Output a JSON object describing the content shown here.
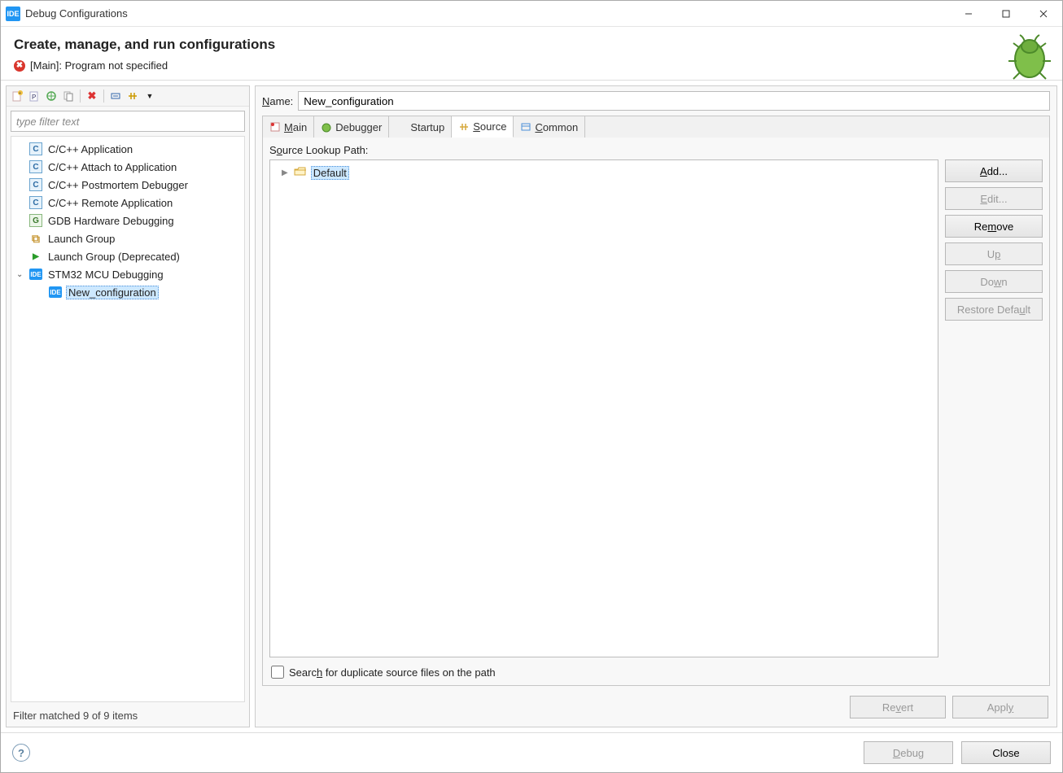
{
  "window": {
    "title": "Debug Configurations"
  },
  "header": {
    "heading": "Create, manage, and run configurations",
    "errorText": "[Main]: Program not specified"
  },
  "leftPane": {
    "filterPlaceholder": "type filter text",
    "statusText": "Filter matched 9 of 9 items",
    "treeItems": [
      {
        "iconType": "c",
        "label": "C/C++ Application"
      },
      {
        "iconType": "c",
        "label": "C/C++ Attach to Application"
      },
      {
        "iconType": "c",
        "label": "C/C++ Postmortem Debugger"
      },
      {
        "iconType": "c",
        "label": "C/C++ Remote Application"
      },
      {
        "iconType": "g",
        "label": "GDB Hardware Debugging"
      },
      {
        "iconType": "grp",
        "label": "Launch Group"
      },
      {
        "iconType": "play",
        "label": "Launch Group (Deprecated)"
      },
      {
        "iconType": "ide",
        "label": "STM32 MCU Debugging",
        "expanded": true
      },
      {
        "iconType": "ide",
        "label": "New_configuration",
        "child": true,
        "selected": true
      }
    ]
  },
  "rightPane": {
    "nameLabel": "Name:",
    "nameValue": "New_configuration",
    "tabs": [
      {
        "id": "main",
        "label": "Main"
      },
      {
        "id": "debugger",
        "label": "Debugger"
      },
      {
        "id": "startup",
        "label": "Startup"
      },
      {
        "id": "source",
        "label": "Source",
        "active": true
      },
      {
        "id": "common",
        "label": "Common"
      }
    ],
    "source": {
      "lookupLabel": "Source Lookup Path:",
      "rootItem": "Default",
      "buttons": {
        "add": "Add...",
        "edit": "Edit...",
        "remove": "Remove",
        "up": "Up",
        "down": "Down",
        "restore": "Restore Default"
      },
      "checkboxLabel": "Search for duplicate source files on the path"
    },
    "revertLabel": "Revert",
    "applyLabel": "Apply"
  },
  "footer": {
    "debugLabel": "Debug",
    "closeLabel": "Close"
  }
}
